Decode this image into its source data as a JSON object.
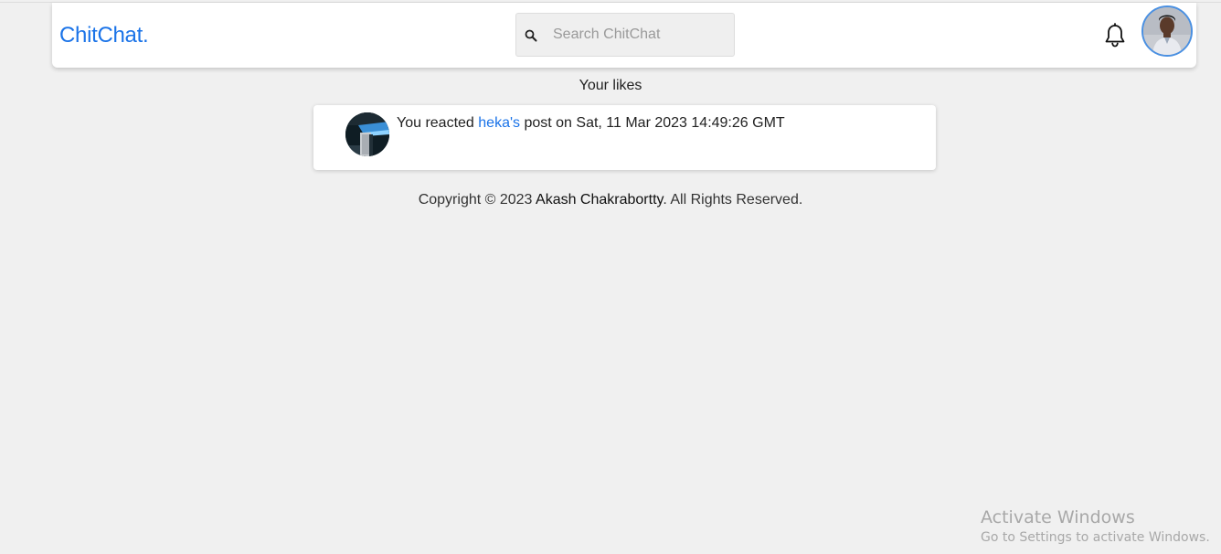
{
  "navbar": {
    "brand": "ChitChat.",
    "search": {
      "placeholder": "Search ChitChat",
      "value": "",
      "icon": "search-icon"
    },
    "notification_icon": "bell-icon",
    "avatar_icon": "user-avatar"
  },
  "main": {
    "section_title": "Your likes",
    "likes": [
      {
        "prefix": "You reacted ",
        "user": "heka's",
        "suffix": " post on Sat, 11 Mar 2023 14:49:26 GMT",
        "thumbnail": "post-thumbnail"
      }
    ]
  },
  "footer": {
    "prefix": "Copyright © 2023 ",
    "author": "Akash Chakrabortty",
    "suffix": ". All Rights Reserved."
  },
  "os_overlay": {
    "title": "Activate Windows",
    "subtitle": "Go to Settings to activate Windows."
  },
  "colors": {
    "accent": "#1a73e8",
    "background": "#f0f0f0",
    "avatar_ring": "#4a90e2"
  }
}
